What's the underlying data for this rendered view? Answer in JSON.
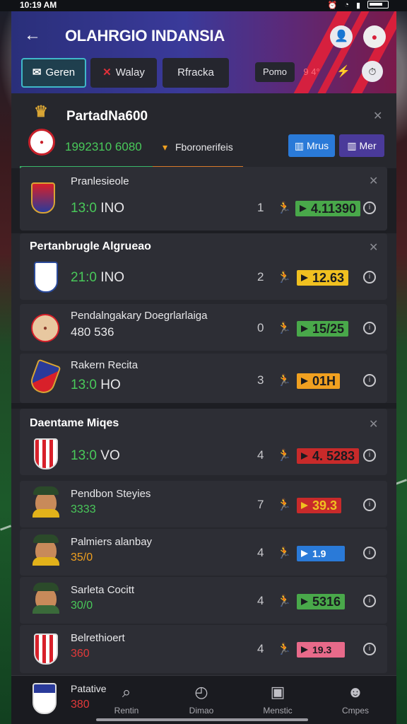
{
  "status": {
    "time": "10:19 AM"
  },
  "header": {
    "title": "OLAHRGIO INDANSIA",
    "tabs": [
      {
        "label": "Geren",
        "icon": "envelope-icon"
      },
      {
        "label": "Walay",
        "icon": "cross-icon"
      },
      {
        "label": "Rfracka"
      },
      {
        "label": "Pomo"
      },
      {
        "label": "9 4°"
      }
    ]
  },
  "top_card": {
    "title": "PartadNa600",
    "value": "1992310 6080",
    "sub": "Fboronerifeis",
    "btn_primary": "Mrus",
    "btn_secondary": "Mer"
  },
  "panel_first": {
    "name": "Pranlesieole",
    "score_main": "13:0",
    "score_suffix": "INO",
    "rank": "1",
    "badge": "4.11390"
  },
  "section_two": {
    "title": "Pertanbrugle Algrueao",
    "rows": [
      {
        "name": "",
        "score": "21:0",
        "suffix": "INO",
        "rank": "2",
        "badge": "12.63"
      },
      {
        "name": "Pendalngakary Doegrlarlaiga",
        "score": "480 536",
        "suffix": "",
        "rank": "0",
        "badge": "15/25"
      },
      {
        "name": "Rakern Recita",
        "score": "13:0",
        "suffix": "HO",
        "rank": "3",
        "badge": "01H"
      }
    ]
  },
  "section_three": {
    "title": "Daentame Miqes",
    "first": {
      "score": "13:0",
      "suffix": "VO",
      "rank": "4",
      "badge": "4. 5283"
    },
    "rows": [
      {
        "name": "Pendbon Steyies",
        "sub": "3333",
        "rank": "7",
        "badge": "39.3"
      },
      {
        "name": "Palmiers alanbay",
        "sub": "35/0",
        "rank": "4",
        "badge": "1.9"
      },
      {
        "name": "Sarleta Cocitt",
        "sub": "30/0",
        "rank": "4",
        "badge": "5316"
      },
      {
        "name": "Belrethioert",
        "sub": "360",
        "rank": "4",
        "badge": "19.3"
      }
    ]
  },
  "bottom_nav": {
    "current": {
      "name": "Patative",
      "sub": "380"
    },
    "items": [
      {
        "label": "Rentin",
        "icon": "search-icon"
      },
      {
        "label": "Dimao",
        "icon": "compass-icon"
      },
      {
        "label": "Menstic",
        "icon": "calendar-icon"
      },
      {
        "label": "Cmpes",
        "icon": "profile-icon"
      }
    ]
  }
}
